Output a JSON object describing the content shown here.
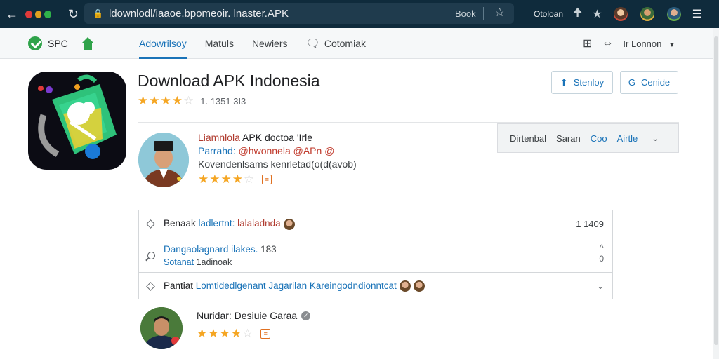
{
  "browser": {
    "url": "ldownlodl/iaaoe.bpomeoir. lnaster.APK",
    "url_side_label": "Book",
    "profile_label": "Otoloan",
    "dot_colors": [
      "#e03a3a",
      "#e0a020",
      "#2fb24a"
    ]
  },
  "nav": {
    "brand": "SPC",
    "tabs": [
      {
        "label": "Adowrilsoy",
        "active": true
      },
      {
        "label": "Matuls",
        "active": false
      },
      {
        "label": "Newiers",
        "active": false
      },
      {
        "label": "Cotomiak",
        "active": false
      }
    ],
    "account_label": "Lonnon"
  },
  "app": {
    "title": "Download APK Indonesia",
    "rating_stars": 3.5,
    "rating_text": "1. 1351 3I3",
    "share_label": "Stenloy",
    "gen_label": "Cenide",
    "gen_prefix": "G"
  },
  "author": {
    "line1_red": "Liamnlola",
    "line1_rest": " APK doctoa 'Irle",
    "line2_blue": "Parrahd: ",
    "line2_red": "@hwonnela @APn @",
    "line3": "Kovendenlsams kenrletad(o(d(avob)",
    "stars": 4
  },
  "filter": {
    "items": [
      {
        "label": "Dirtenbal",
        "blue": false
      },
      {
        "label": "Saran",
        "blue": false
      },
      {
        "label": "Coo",
        "blue": true
      },
      {
        "label": "Airtle",
        "blue": true
      }
    ]
  },
  "list": {
    "row1": {
      "prefix": "Benaak ",
      "blue": "ladlertnt:",
      "red": " lalaladnda",
      "right": "1 1409"
    },
    "row2": {
      "line1_blue": "Dangaolagnard ilakes.",
      "line1_dark": " 183",
      "line2_blue": "Sotanat",
      "line2_rest": " 1adinoak",
      "up": "^",
      "down": "0"
    },
    "row3": {
      "prefix": "Pantiat ",
      "blue": "Lomtidedlgenant Jagarilan Kareingodndionntcat"
    }
  },
  "author2": {
    "name": "Nuridar: Desiuie Garaa",
    "stars": 4
  },
  "colors": {
    "accent": "#1a73b8",
    "star": "#f5a623",
    "chrome": "#0f2b3c"
  }
}
